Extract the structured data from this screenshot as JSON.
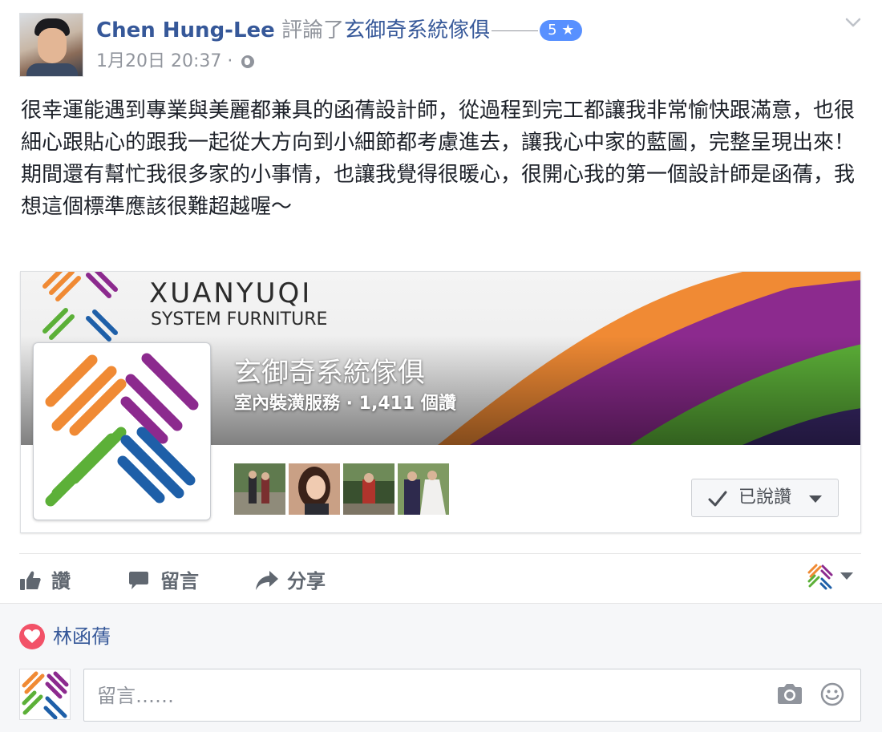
{
  "post": {
    "author": "Chen Hung-Lee",
    "verb": "評論了",
    "target_page": "玄御奇系統傢俱",
    "rating": "5",
    "rating_star": "★",
    "timestamp": "1月20日 20:37",
    "timestamp_sep": "·",
    "audience_icon": "globe-icon",
    "body": [
      "很幸運能遇到專業與美麗都兼具的函蒨設計師，從過程到完工都讓我非常愉快跟滿意，也很細心跟貼心的跟我一起從大方向到小細節都考慮進去，讓我心中家的藍圖，完整呈現出來！",
      "期間還有幫忙我很多家的小事情，也讓我覺得很暖心，很開心我的第一個設計師是函蒨，我想這個標準應該很難超越喔～"
    ]
  },
  "page_card": {
    "cover_brand": "XUANYUQI",
    "cover_tagline": "SYSTEM FURNITURE",
    "name": "玄御奇系統傢俱",
    "meta": "室內裝潢服務 · 1,411 個讚",
    "liked_label": "已說讚",
    "friend_thumbs": [
      "friend-photo-1",
      "friend-photo-2",
      "friend-photo-3",
      "friend-photo-4"
    ]
  },
  "actions": {
    "like": "讚",
    "comment": "留言",
    "share": "分享"
  },
  "reactions": {
    "icon": "heart-icon",
    "name": "林函蒨"
  },
  "composer": {
    "placeholder": "留言……",
    "camera_icon": "camera-icon",
    "emoji_icon": "emoji-icon"
  },
  "colors": {
    "link": "#365899",
    "meta": "#90949c",
    "badge": "#5890ff",
    "heart": "#f25268",
    "logo_orange": "#f08a34",
    "logo_purple": "#8c2a8e",
    "logo_green": "#5cb038",
    "logo_blue": "#1e5fa8"
  }
}
